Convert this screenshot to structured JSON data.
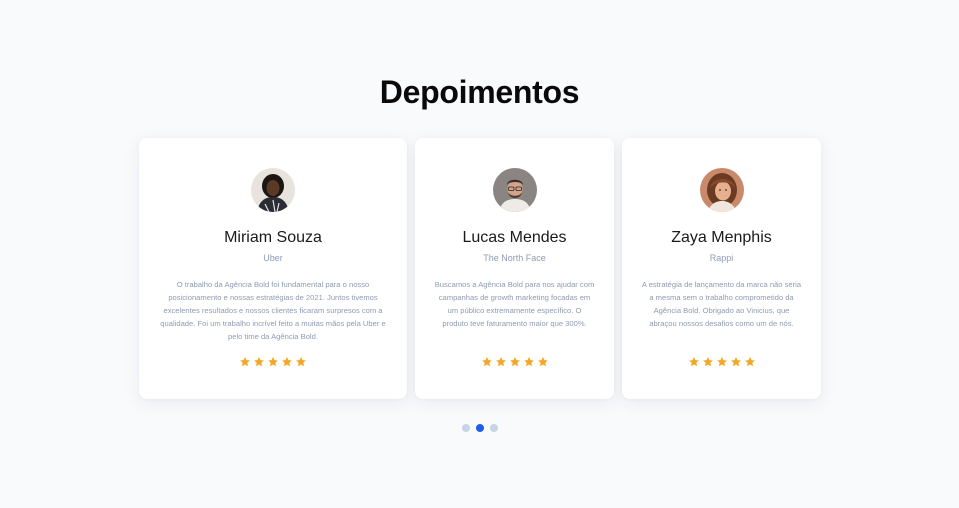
{
  "section": {
    "title": "Depoimentos"
  },
  "testimonials": [
    {
      "name": "Miriam Souza",
      "company": "Uber",
      "quote": "O trabalho da Agência Bold foi fundamental para o nosso posicionamento e nossas estratégias de 2021. Juntos tivemos excelentes resultados e nossos clientes ficaram surpresos com a qualidade. Foi um trabalho incrível feito a muitas mãos pela Uber e pelo time da Agência Bold.",
      "rating": 5,
      "avatar_icon": "avatar-photo"
    },
    {
      "name": "Lucas Mendes",
      "company": "The North Face",
      "quote": "Buscamos a Agência Bold para nos ajudar com campanhas de growth marketing focadas em um público extremamente específico. O produto teve faturamento maior que 300%.",
      "rating": 5,
      "avatar_icon": "avatar-photo"
    },
    {
      "name": "Zaya Menphis",
      "company": "Rappi",
      "quote": "A estratégia de lançamento da marca não seria a mesma sem o trabalho comprometido da Agência Bold. Obrigado ao Vinicius, que abraçou nossos desafios como um de nós.",
      "rating": 5,
      "avatar_icon": "avatar-photo"
    }
  ],
  "pagination": {
    "pages": 3,
    "active_index": 1
  },
  "colors": {
    "background": "#f9fafc",
    "card": "#ffffff",
    "star": "#f5a623",
    "dot_active": "#1f5ee8",
    "dot_inactive": "#c9d3e6",
    "muted_text": "#8f9bb3"
  }
}
